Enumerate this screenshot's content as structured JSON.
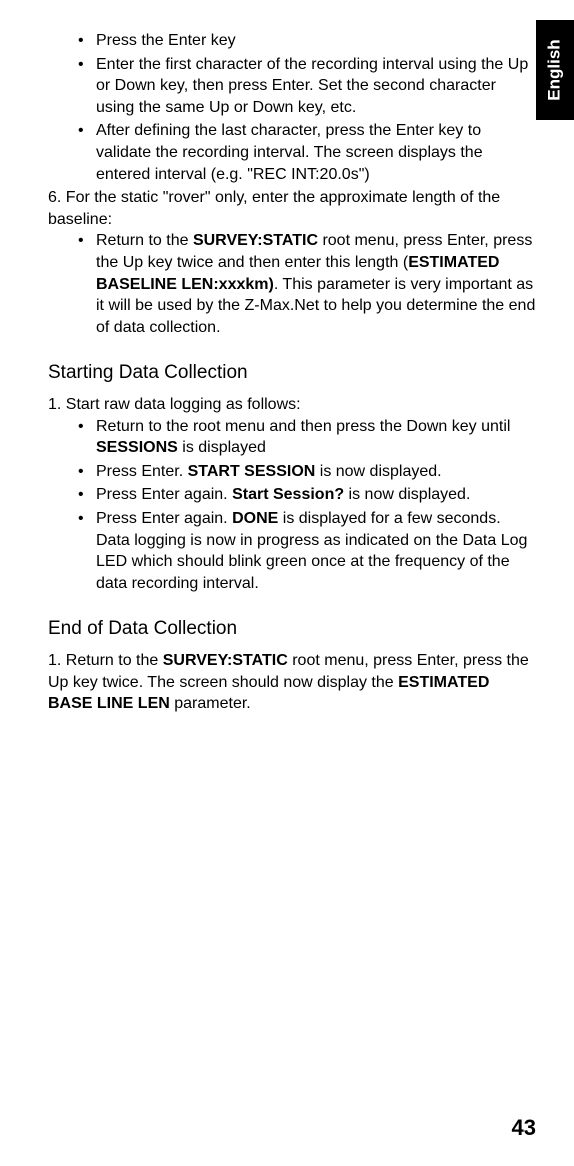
{
  "langTab": "English",
  "topBullets": {
    "b1": "Press the Enter key",
    "b2": "Enter the first character of the recording interval using the Up or Down key, then press Enter. Set the second character using the same Up or Down key, etc.",
    "b3": "After defining the last character, press the Enter key to validate the recording interval. The screen displays the entered interval (e.g. \"REC INT:20.0s\")"
  },
  "step6": {
    "lead": "6. For the static \"rover\" only, enter the approximate length of the baseline:",
    "bullet_pre": "Return to the ",
    "bullet_bold1": "SURVEY:STATIC",
    "bullet_mid1": " root menu, press Enter, press the Up key twice and then enter this length (",
    "bullet_bold2": "ESTIMATED BASELINE LEN:xxxkm)",
    "bullet_post": ". This parameter is very important as it will be used by the Z-Max.Net to help you determine the end of data collection."
  },
  "h1": "Starting Data Collection",
  "start": {
    "step1": "1. Start raw data logging as follows:",
    "b1_pre": "Return to the root menu and then press the Down key until ",
    "b1_bold": "SESSIONS",
    "b1_post": " is displayed",
    "b2_pre": "Press Enter. ",
    "b2_bold": "START SESSION",
    "b2_post": " is now displayed.",
    "b3_pre": "Press Enter again. ",
    "b3_bold": "Start Session?",
    "b3_post": " is now displayed.",
    "b4_pre": "Press Enter again. ",
    "b4_bold": "DONE",
    "b4_post": " is displayed for a few seconds. Data logging is now in progress as indicated on the Data Log LED which should blink green once at the frequency of the data recording interval."
  },
  "h2": "End of Data Collection",
  "end": {
    "pre": "1. Return to the ",
    "bold1": "SURVEY:STATIC",
    "mid": " root menu, press Enter, press the Up key twice. The screen should now display the ",
    "bold2": "ESTIMATED BASE LINE LEN",
    "post": " parameter."
  },
  "pageNum": "43"
}
